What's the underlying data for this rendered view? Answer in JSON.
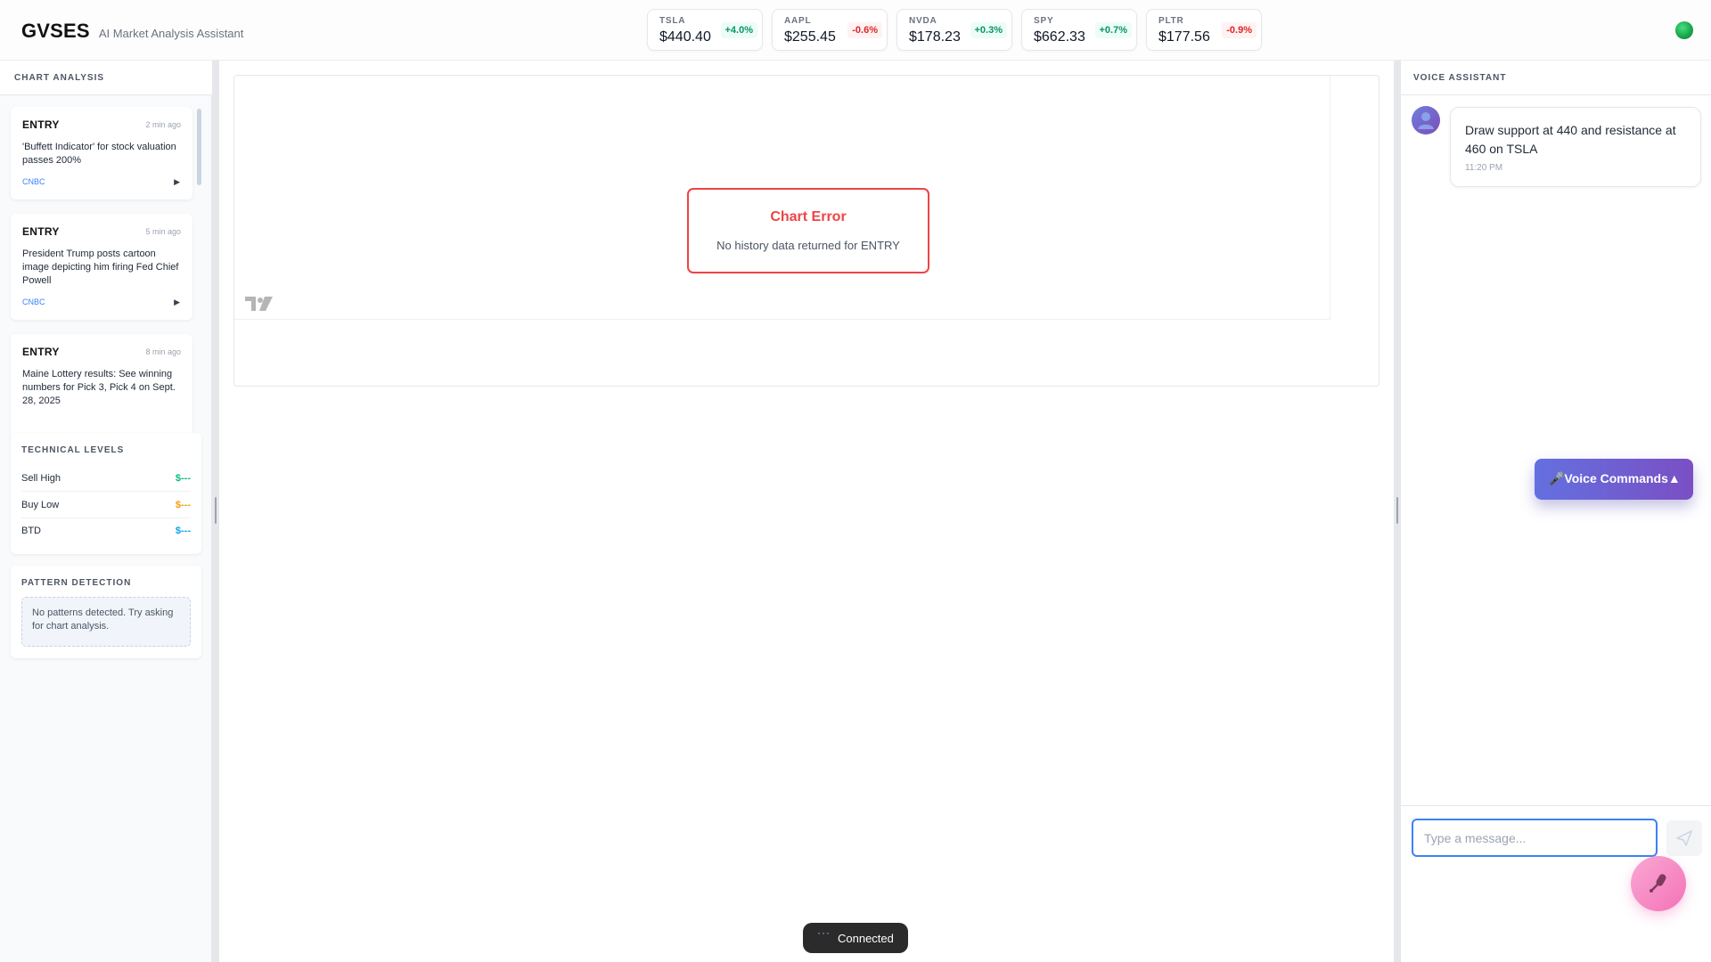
{
  "header": {
    "brand": "GVSES",
    "subtitle": "AI Market Analysis Assistant",
    "tickers": [
      {
        "symbol": "TSLA",
        "price": "$440.40",
        "change": "+4.0%"
      },
      {
        "symbol": "AAPL",
        "price": "$255.45",
        "change": "-0.6%"
      },
      {
        "symbol": "NVDA",
        "price": "$178.23",
        "change": "+0.3%"
      },
      {
        "symbol": "SPY",
        "price": "$662.33",
        "change": "+0.7%"
      },
      {
        "symbol": "PLTR",
        "price": "$177.56",
        "change": "-0.9%"
      }
    ],
    "status_color": "#22c55e"
  },
  "left": {
    "title": "CHART ANALYSIS",
    "news": [
      {
        "symbol": "ENTRY",
        "time": "2 min ago",
        "title": "'Buffett Indicator' for stock valuation passes 200%",
        "source": "CNBC",
        "play": "▶"
      },
      {
        "symbol": "ENTRY",
        "time": "5 min ago",
        "title": "President Trump posts cartoon image depicting him firing Fed Chief Powell",
        "source": "CNBC",
        "play": "▶"
      },
      {
        "symbol": "ENTRY",
        "time": "8 min ago",
        "title": "Maine Lottery results: See winning numbers for Pick 3, Pick 4 on Sept. 28, 2025",
        "source": "",
        "play": ""
      }
    ],
    "technical": {
      "title": "TECHNICAL LEVELS",
      "levels": [
        {
          "label": "Sell High",
          "value": "$---",
          "color": "#10b981"
        },
        {
          "label": "Buy Low",
          "value": "$---",
          "color": "#f59e0b"
        },
        {
          "label": "BTD",
          "value": "$---",
          "color": "#0ea5e9"
        }
      ]
    },
    "patterns": {
      "title": "PATTERN DETECTION",
      "empty": "No patterns detected. Try asking for chart analysis."
    }
  },
  "center": {
    "error_title": "Chart Error",
    "error_message": "No history data returned for ENTRY",
    "toast": "Connected",
    "toast_icon": "ellipsis-icon"
  },
  "right": {
    "title": "VOICE ASSISTANT",
    "message": {
      "text": "Draw support at 440 and resistance at 460 on TSLA",
      "time": "11:20 PM"
    },
    "voice_commands": "🎤Voice Commands▲",
    "input_placeholder": "Type a message...",
    "send_icon": "send-icon",
    "mic_icon": "microphone-icon"
  }
}
